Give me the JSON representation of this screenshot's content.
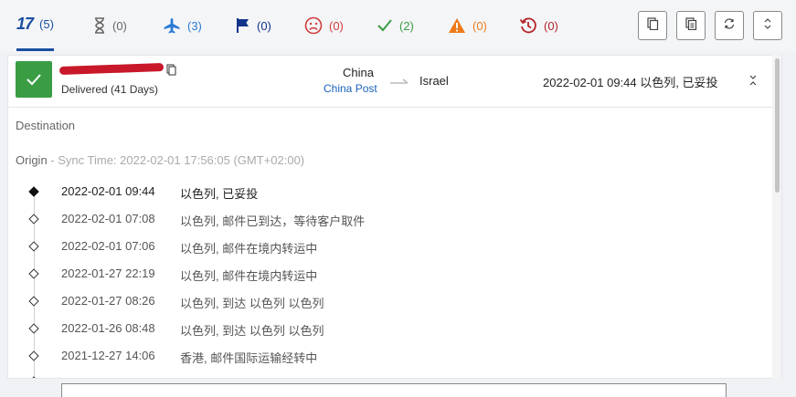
{
  "filters": [
    {
      "name": "all",
      "icon": "17track-logo",
      "label": "17",
      "count": "(5)",
      "color": "#1a4fa0"
    },
    {
      "name": "pending",
      "icon": "hourglass-icon",
      "count": "(0)",
      "color": "#666666"
    },
    {
      "name": "in-transit",
      "icon": "airplane-icon",
      "count": "(3)",
      "color": "#2b7bd6"
    },
    {
      "name": "pickup",
      "icon": "flag-icon",
      "count": "(0)",
      "color": "#12348a"
    },
    {
      "name": "undelivered",
      "icon": "sad-face-icon",
      "count": "(0)",
      "color": "#d23c3c"
    },
    {
      "name": "delivered",
      "icon": "checkmark-icon",
      "count": "(2)",
      "color": "#3a9d44"
    },
    {
      "name": "alert",
      "icon": "warning-icon",
      "count": "(0)",
      "color": "#ef7a1a"
    },
    {
      "name": "expired",
      "icon": "history-icon",
      "count": "(0)",
      "color": "#b5242a"
    }
  ],
  "toolbar": [
    "copy-icon",
    "copy-all-icon",
    "refresh-icon",
    "expand-icon"
  ],
  "shipment": {
    "status": "Delivered (41 Days)",
    "origin_country": "China",
    "carrier": "China Post",
    "destination_country": "Israel",
    "last_event": "2022-02-01 09:44  以色列, 已妥投"
  },
  "sections": {
    "destination": "Destination",
    "origin": "Origin",
    "sync": " - Sync Time: 2022-02-01 17:56:05 (GMT+02:00)"
  },
  "events": [
    {
      "time": "2022-02-01 09:44",
      "desc": "以色列, 已妥投"
    },
    {
      "time": "2022-02-01 07:08",
      "desc": "以色列, 邮件已到达，等待客户取件"
    },
    {
      "time": "2022-02-01 07:06",
      "desc": "以色列, 邮件在境内转运中"
    },
    {
      "time": "2022-01-27 22:19",
      "desc": "以色列, 邮件在境内转运中"
    },
    {
      "time": "2022-01-27 08:26",
      "desc": "以色列, 到达 以色列 以色列"
    },
    {
      "time": "2022-01-26 08:48",
      "desc": "以色列, 到达 以色列 以色列"
    },
    {
      "time": "2021-12-27 14:06",
      "desc": "香港, 邮件国际运输经转中"
    }
  ],
  "colors": {
    "accent": "#1a4fa0",
    "delivered": "#3a9d44",
    "carrier_link": "#1a62b8"
  }
}
